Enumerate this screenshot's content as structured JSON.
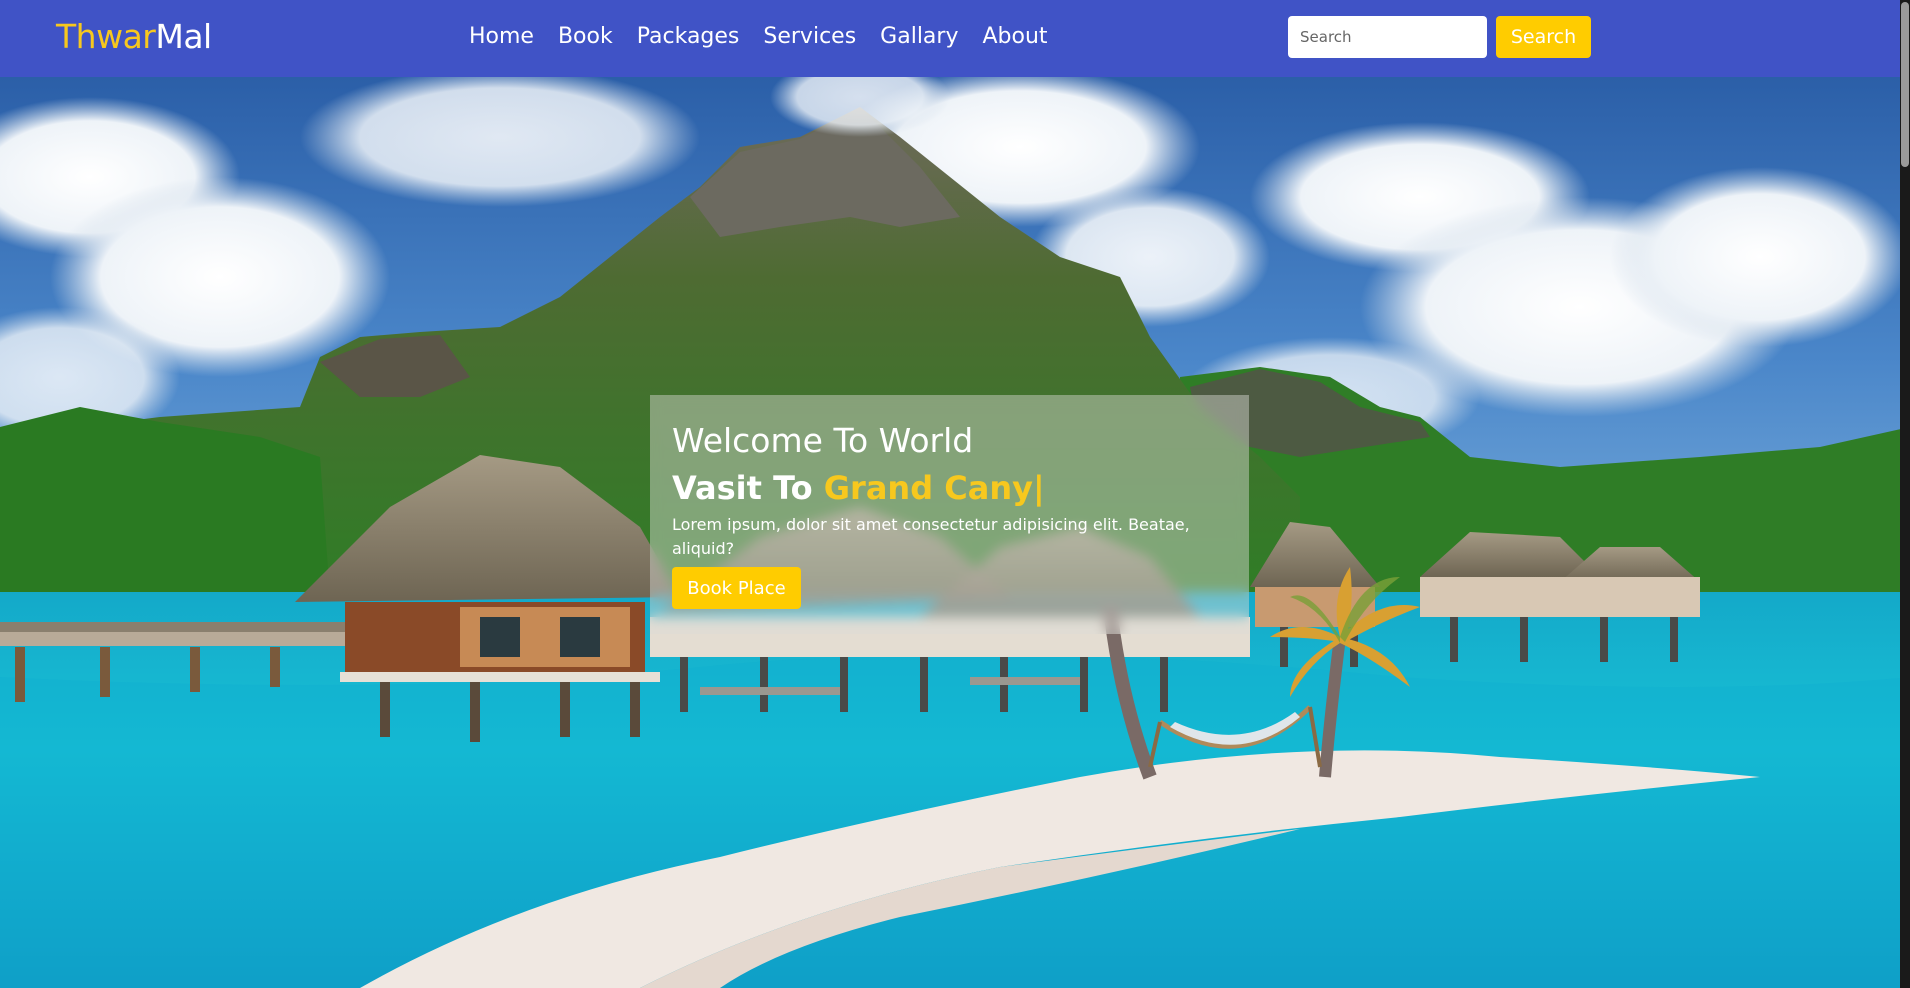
{
  "navbar": {
    "logo_part1": "Thwar",
    "logo_part2": "Mal",
    "links": [
      "Home",
      "Book",
      "Packages",
      "Services",
      "Gallary",
      "About"
    ],
    "search_placeholder": "Search",
    "search_button": "Search"
  },
  "hero": {
    "welcome": "Welcome To World",
    "heading_prefix": "Vasit To ",
    "heading_typed": "Grand Cany",
    "heading_cursor": "|",
    "description": "Lorem ipsum, dolor sit amet consectetur adipisicing elit. Beatae, aliquid?",
    "button_label": "Book Place"
  },
  "colors": {
    "navbar_bg": "#4053c6",
    "accent_yellow": "#ffcc00",
    "logo_accent": "#f7c81e"
  }
}
